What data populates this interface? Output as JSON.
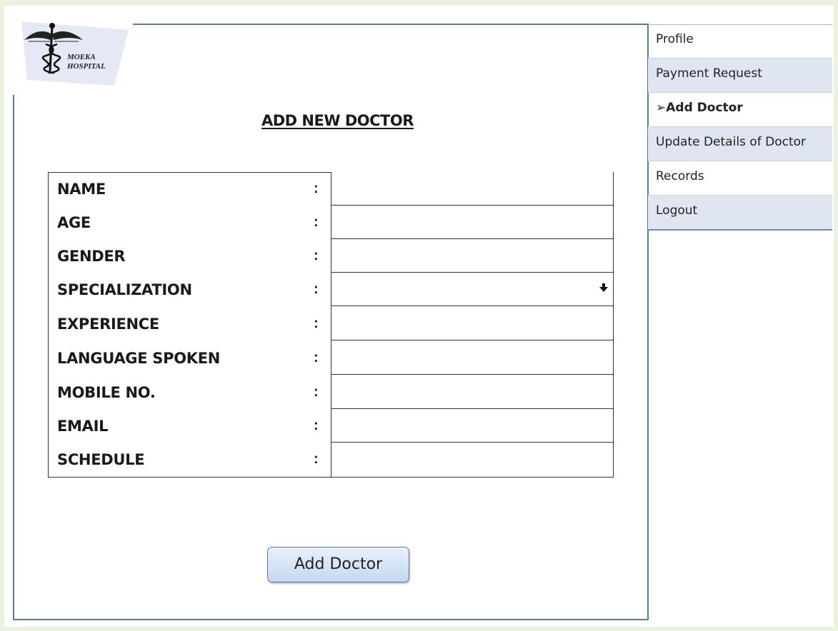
{
  "logo": {
    "line1": "MOEKA",
    "line2": "HOSPITAL"
  },
  "page_title": "ADD NEW DOCTOR",
  "form": {
    "fields": [
      {
        "label": "NAME",
        "colon": ":"
      },
      {
        "label": "AGE",
        "colon": ":"
      },
      {
        "label": "GENDER",
        "colon": ":"
      },
      {
        "label": "SPECIALIZATION",
        "colon": ":"
      },
      {
        "label": "EXPERIENCE",
        "colon": ":"
      },
      {
        "label": "LANGUAGE SPOKEN",
        "colon": ":"
      },
      {
        "label": "MOBILE NO.",
        "colon": ":"
      },
      {
        "label": "EMAIL",
        "colon": ":"
      },
      {
        "label": "SCHEDULE",
        "colon": ":"
      }
    ],
    "submit_label": "Add Doctor"
  },
  "sidebar": {
    "items": [
      {
        "label": "Profile"
      },
      {
        "label": "Payment Request"
      },
      {
        "label": "➢Add Doctor"
      },
      {
        "label": "Update Details of Doctor"
      },
      {
        "label": "Records"
      },
      {
        "label": "Logout"
      }
    ]
  },
  "colors": {
    "accent": "#587aa0",
    "page_bg": "#ebf3de",
    "sidebar_alt": "#dfe6f1"
  }
}
